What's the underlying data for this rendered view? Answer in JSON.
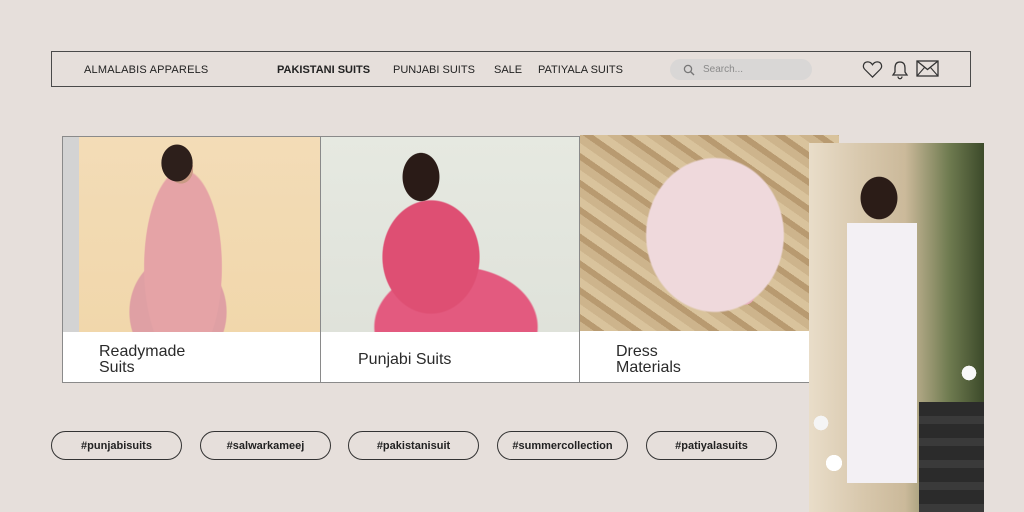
{
  "header": {
    "brand": "ALMALABIS APPARELS",
    "nav": [
      "PAKISTANI SUITS",
      "PUNJABI SUITS",
      "SALE",
      "PATIYALA SUITS"
    ],
    "active_nav": "PAKISTANI SUITS",
    "search": {
      "placeholder": "Search..."
    },
    "icons": [
      "heart-icon",
      "bell-icon",
      "mail-icon"
    ]
  },
  "categories": [
    {
      "label_line1": "Readymade",
      "label_line2": "Suits"
    },
    {
      "label_line1": "Punjabi Suits",
      "label_line2": ""
    },
    {
      "label_line1": "Dress",
      "label_line2": "Materials"
    }
  ],
  "hashtags": [
    "#punjabisuits",
    "#salwarkameej",
    "#pakistanisuit",
    "#summercollection",
    "#patiyalasuits"
  ],
  "colors": {
    "background": "#e6dfdb",
    "search_bg": "#d9d7d6",
    "border": "#4a4a4a"
  }
}
